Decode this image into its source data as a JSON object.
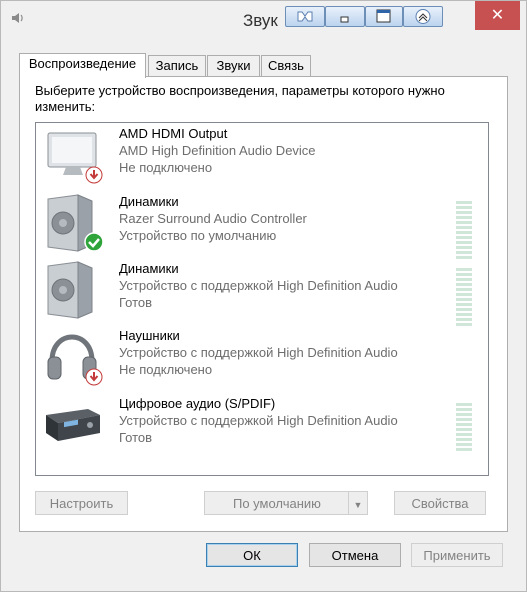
{
  "window": {
    "title": "Звук"
  },
  "tabs": [
    {
      "label": "Воспроизведение",
      "active": true
    },
    {
      "label": "Запись"
    },
    {
      "label": "Звуки"
    },
    {
      "label": "Связь"
    }
  ],
  "instruction": "Выберите устройство воспроизведения, параметры которого нужно изменить:",
  "devices": [
    {
      "name": "AMD HDMI Output",
      "description": "AMD High Definition Audio Device",
      "status": "Не подключено",
      "icon": "monitor-icon",
      "badge": "disconnected-badge-icon",
      "meter": false
    },
    {
      "name": "Динамики",
      "description": "Razer Surround Audio Controller",
      "status": "Устройство по умолчанию",
      "icon": "speaker-icon",
      "badge": "default-checkmark-icon",
      "meter": true
    },
    {
      "name": "Динамики",
      "description": "Устройство с поддержкой High Definition Audio",
      "status": "Готов",
      "icon": "speaker-icon",
      "badge": null,
      "meter": true
    },
    {
      "name": "Наушники",
      "description": "Устройство с поддержкой High Definition Audio",
      "status": "Не подключено",
      "icon": "headphones-icon",
      "badge": "disconnected-badge-icon",
      "meter": false
    },
    {
      "name": "Цифровое аудио (S/PDIF)",
      "description": "Устройство с поддержкой High Definition Audio",
      "status": "Готов",
      "icon": "digital-receiver-icon",
      "badge": null,
      "meter": true
    }
  ],
  "buttons": {
    "configure": "Настроить",
    "set_default": "По умолчанию",
    "properties": "Свойства",
    "ok": "ОК",
    "cancel": "Отмена",
    "apply": "Применить"
  },
  "colors": {
    "close_button": "#c75050",
    "default_check": "#2ea43a",
    "disconnected_badge": "#c43a3a",
    "level_meter": "#cfe6d8"
  }
}
